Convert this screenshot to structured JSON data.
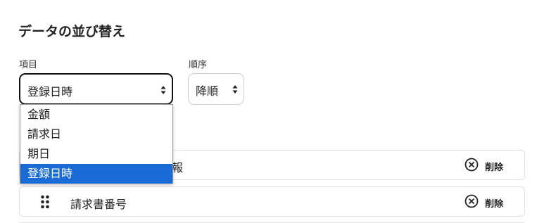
{
  "section_title": "データの並び替え",
  "item_select": {
    "label": "項目",
    "value": "登録日時",
    "options": [
      "金額",
      "請求日",
      "期日",
      "登録日時"
    ],
    "selected_index": 3
  },
  "order_select": {
    "label": "順序",
    "value": "降順"
  },
  "sort_rows": [
    {
      "label": "報",
      "delete_label": "削除"
    },
    {
      "label": "請求書番号",
      "delete_label": "削除"
    }
  ],
  "colors": {
    "selected_option": "#1a6bd6",
    "border": "#e0e0e0"
  },
  "icons": {
    "delete": "circle-x-icon",
    "drag": "drag-handle-icon",
    "select": "updown-arrows-icon"
  }
}
